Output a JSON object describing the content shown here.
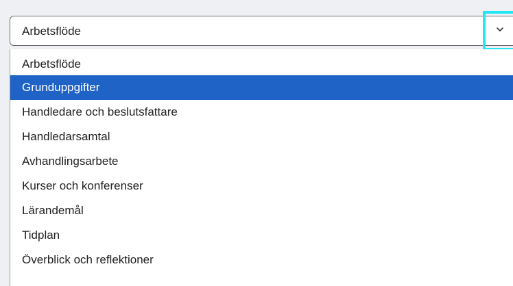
{
  "select": {
    "value": "Arbetsflöde",
    "icon": "chevron-down-icon",
    "focus_color": "#22e6f2"
  },
  "dropdown": {
    "selected_index": 1,
    "highlight_color": "#1f63c6",
    "options": [
      {
        "label": "Arbetsflöde"
      },
      {
        "label": "Grunduppgifter"
      },
      {
        "label": "Handledare och beslutsfattare"
      },
      {
        "label": "Handledarsamtal"
      },
      {
        "label": "Avhandlingsarbete"
      },
      {
        "label": "Kurser och konferenser"
      },
      {
        "label": "Lärandemål"
      },
      {
        "label": "Tidplan"
      },
      {
        "label": "Överblick och reflektioner"
      }
    ]
  }
}
